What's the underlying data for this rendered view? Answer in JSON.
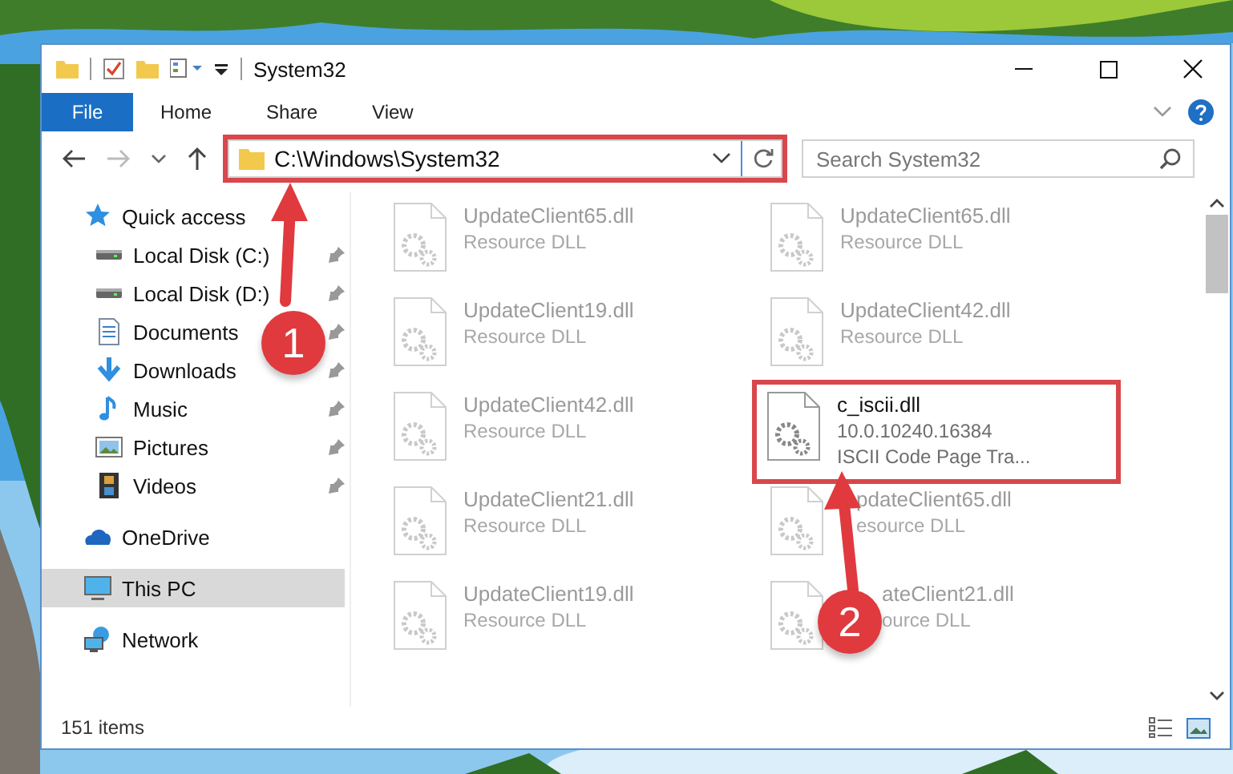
{
  "window": {
    "title": "System32"
  },
  "ribbon_tabs": [
    {
      "label": "File",
      "kind": "file"
    },
    {
      "label": "Home",
      "kind": "tab"
    },
    {
      "label": "Share",
      "kind": "tab"
    },
    {
      "label": "View",
      "kind": "tab"
    }
  ],
  "address": {
    "path": "C:\\Windows\\System32",
    "annotated": true
  },
  "search": {
    "placeholder": "Search System32"
  },
  "sidebar": {
    "items": [
      {
        "label": "Quick access",
        "kind": "star",
        "selected": false,
        "children": [
          {
            "label": "Local Disk (C:)",
            "kind": "drive",
            "pinned": true,
            "selected": false
          },
          {
            "label": "Local Disk (D:)",
            "kind": "drive",
            "pinned": true,
            "selected": false
          },
          {
            "label": "Documents",
            "kind": "document",
            "pinned": true,
            "selected": false
          },
          {
            "label": "Downloads",
            "kind": "download",
            "pinned": true,
            "selected": false
          },
          {
            "label": "Music",
            "kind": "music",
            "pinned": true,
            "selected": false
          },
          {
            "label": "Pictures",
            "kind": "pictures",
            "pinned": true,
            "selected": false
          },
          {
            "label": "Videos",
            "kind": "videos",
            "pinned": true,
            "selected": false
          }
        ]
      },
      {
        "label": "OneDrive",
        "kind": "cloud",
        "selected": false
      },
      {
        "label": "This PC",
        "kind": "computer",
        "selected": true
      },
      {
        "label": "Network",
        "kind": "network",
        "selected": false
      }
    ]
  },
  "files": [
    {
      "name": "UpdateClient65.dll",
      "details": [
        "Resource DLL"
      ],
      "kind": "plain"
    },
    {
      "name": "UpdateClient65.dll",
      "details": [
        "Resource DLL"
      ],
      "kind": "plain"
    },
    {
      "name": "UpdateClient19.dll",
      "details": [
        "Resource DLL"
      ],
      "kind": "plain"
    },
    {
      "name": "UpdateClient42.dll",
      "details": [
        "Resource DLL"
      ],
      "kind": "plain"
    },
    {
      "name": "UpdateClient42.dll",
      "details": [
        "Resource DLL"
      ],
      "kind": "plain"
    },
    {
      "name": "c_iscii.dll",
      "details": [
        "10.0.10240.16384",
        "ISCII Code Page Tra..."
      ],
      "kind": "highlighted"
    },
    {
      "name": "UpdateClient21.dll",
      "details": [
        "Resource DLL"
      ],
      "kind": "plain"
    },
    {
      "name": "pdateClient65.dll",
      "details": [
        "esource DLL"
      ],
      "kind": "cut-arrow"
    },
    {
      "name": "UpdateClient19.dll",
      "details": [
        "Resource DLL"
      ],
      "kind": "plain"
    },
    {
      "name": "ateClient21.dll",
      "details": [
        "ource DLL"
      ],
      "kind": "cut-badge"
    }
  ],
  "status_bar": {
    "count": "151 items"
  },
  "callouts": [
    {
      "label": "1"
    },
    {
      "label": "2"
    }
  ]
}
